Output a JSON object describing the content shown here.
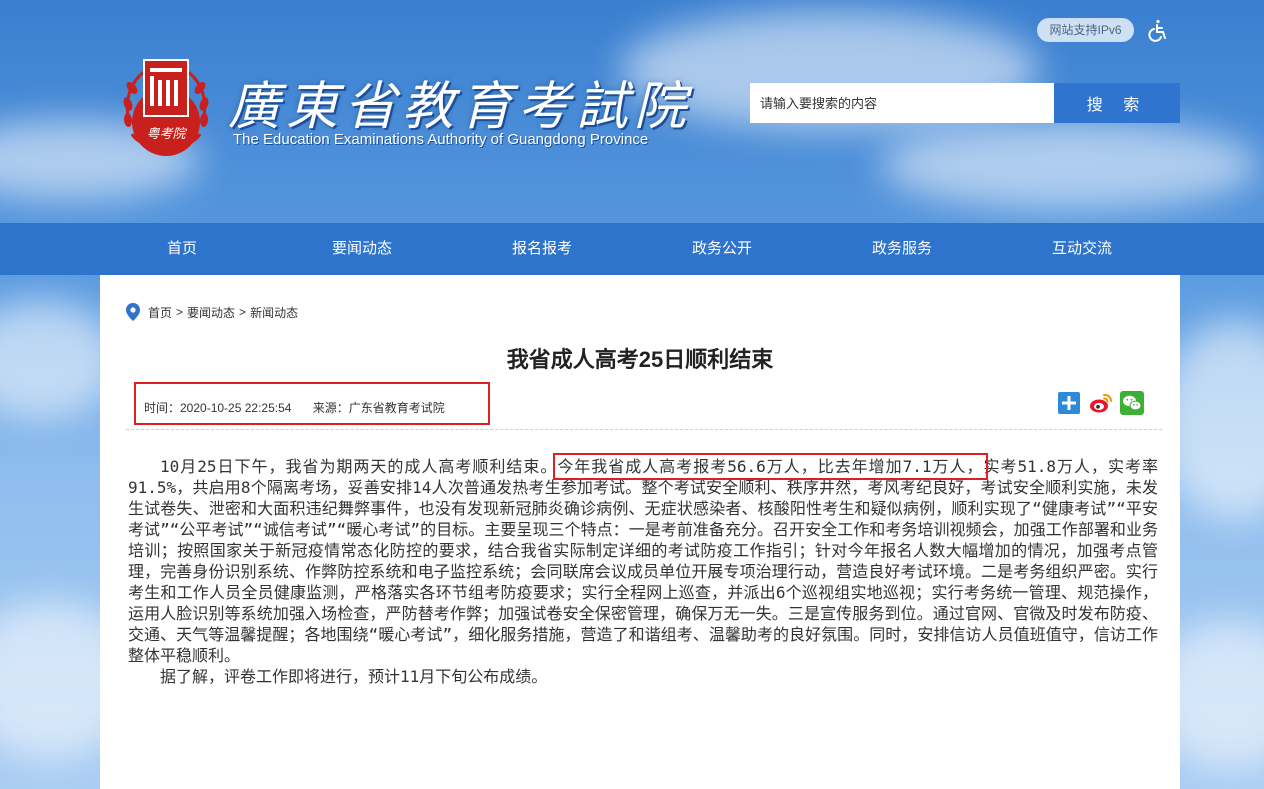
{
  "header": {
    "logo_cn": "廣東省教育考試院",
    "logo_en": "The Education Examinations Authority of Guangdong Province",
    "logo_seal_text": "粤考院",
    "ipv6_badge": "网站支持IPv6",
    "accessibility_icon": "wheelchair-icon",
    "search_placeholder": "请输入要搜索的内容",
    "search_button": "搜 索"
  },
  "nav": {
    "items": [
      {
        "label": "首页"
      },
      {
        "label": "要闻动态"
      },
      {
        "label": "报名报考"
      },
      {
        "label": "政务公开"
      },
      {
        "label": "政务服务"
      },
      {
        "label": "互动交流"
      }
    ]
  },
  "breadcrumb": {
    "home": "首页",
    "sep": ">",
    "level1": "要闻动态",
    "level2": "新闻动态"
  },
  "article": {
    "title": "我省成人高考25日顺利结束",
    "time": "时间：2020-10-25 22:25:54",
    "source": "来源：广东省教育考试院",
    "para1_before": "10月25日下午，我省为期两天的成人高考顺利结束。",
    "para1_highlight": "今年我省成人高考报考56.6万人，比去年增加7.1万人，",
    "para1_after": "实考51.8万人，实考率91.5%，共启用8个隔离考场，妥善安排14人次普通发热考生参加考试。整个考试安全顺利、秩序井然，考风考纪良好，考试安全顺利实施，未发生试卷失、泄密和大面积违纪舞弊事件，也没有发现新冠肺炎确诊病例、无症状感染者、核酸阳性考生和疑似病例，顺利实现了“健康考试”“平安考试”“公平考试”“诚信考试”“暖心考试”的目标。主要呈现三个特点：一是考前准备充分。召开安全工作和考务培训视频会，加强工作部署和业务培训；按照国家关于新冠疫情常态化防控的要求，结合我省实际制定详细的考试防疫工作指引；针对今年报名人数大幅增加的情况，加强考点管理，完善身份识别系统、作弊防控系统和电子监控系统；会同联席会议成员单位开展专项治理行动，营造良好考试环境。二是考务组织严密。实行考生和工作人员全员健康监测，严格落实各环节组考防疫要求；实行全程网上巡查，并派出6个巡视组实地巡视；实行考务统一管理、规范操作，运用人脸识别等系统加强入场检查，严防替考作弊；加强试卷安全保密管理，确保万无一失。三是宣传服务到位。通过官网、官微及时发布防疫、交通、天气等温馨提醒；各地围绕“暖心考试”，细化服务措施，营造了和谐组考、温馨助考的良好氛围。同时，安排信访人员值班值守，信访工作整体平稳顺利。",
    "para2": "据了解，评卷工作即将进行，预计11月下旬公布成绩。"
  },
  "share": {
    "icons": [
      "plus-share-icon",
      "weibo-icon",
      "wechat-icon"
    ]
  },
  "colors": {
    "nav_bg": "#2e73cc",
    "search_button": "#2f74cf",
    "highlight_border": "#e02020",
    "seal_red": "#c8201c"
  }
}
